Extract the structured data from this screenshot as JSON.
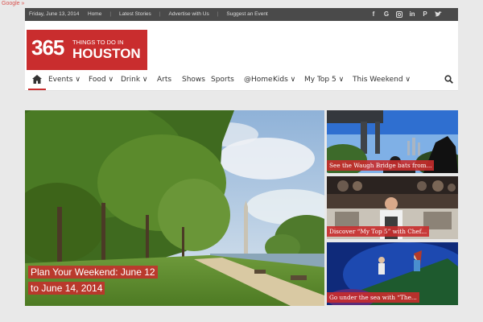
{
  "google_tag": "Google »",
  "topbar": {
    "date": "Friday, June 13, 2014",
    "links": [
      "Home",
      "Latest Stories",
      "Advertise with Us",
      "Suggest an Event"
    ],
    "social_icons": [
      "facebook-icon",
      "google-plus-icon",
      "instagram-icon",
      "linkedin-icon",
      "pinterest-icon",
      "twitter-icon"
    ]
  },
  "logo": {
    "number": "365",
    "line1": "THINGS TO DO IN",
    "line2": "HOUSTON"
  },
  "nav": {
    "items": [
      "Events ∨",
      "Food ∨",
      "Drink ∨",
      "Arts",
      "Shows",
      "Sports",
      "@Home",
      "Kids ∨",
      "My Top 5 ∨",
      "This Weekend ∨"
    ]
  },
  "hero": {
    "caption_line1": "Plan Your Weekend: June 12",
    "caption_line2": "to June 14, 2014"
  },
  "cards": [
    {
      "caption": "See the Waugh Bridge bats from..."
    },
    {
      "caption": "Discover “My Top 5” with Chef..."
    },
    {
      "caption": "Go under the sea with “The..."
    }
  ],
  "colors": {
    "brand": "#c92d2e",
    "topbar": "#4a4a4a"
  }
}
